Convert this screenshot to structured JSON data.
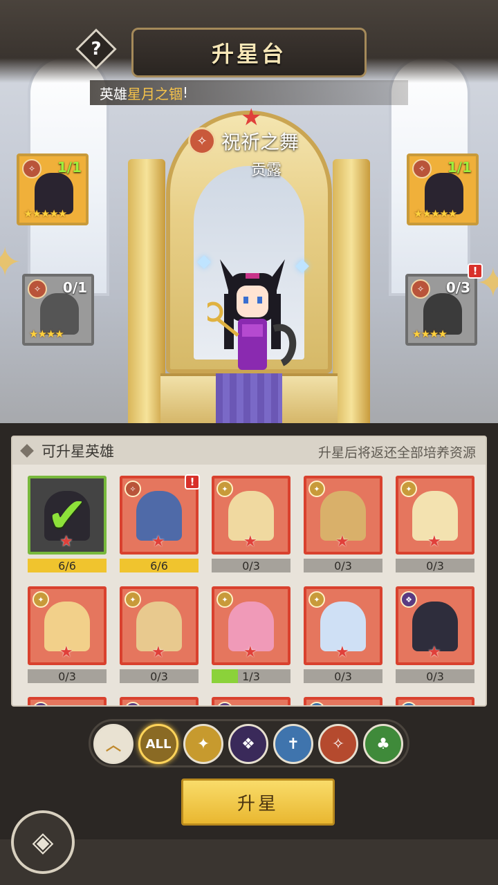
{
  "header": {
    "title": "升星台",
    "help": "?"
  },
  "banner": {
    "prefix": "英雄",
    "highlight": "星月之锢",
    "suffix": "!"
  },
  "featured": {
    "skill_name": "祝祈之舞",
    "hero_name": "贡露",
    "star": "★",
    "faction_icon": "fox-icon"
  },
  "side_cards": [
    {
      "id": "top-left",
      "count": "1/1",
      "stars": "★★★★★",
      "faction_icon": "fox-icon"
    },
    {
      "id": "top-right",
      "count": "1/1",
      "stars": "★★★★★",
      "faction_icon": "fox-icon"
    },
    {
      "id": "mid-left",
      "count": "0/1",
      "stars": "★★★★",
      "faction_icon": "fox-icon"
    },
    {
      "id": "mid-right",
      "count": "0/3",
      "stars": "★★★★",
      "faction_icon": "fox-icon",
      "alert": "!"
    }
  ],
  "panel": {
    "title": "可升星英雄",
    "note": "升星后将返还全部培养资源"
  },
  "heroes": [
    {
      "progress": "6/6",
      "fill_ratio": 1.0,
      "fill_color": "#f0c42e",
      "selected": true
    },
    {
      "progress": "6/6",
      "fill_ratio": 1.0,
      "fill_color": "#f0c42e",
      "alert": "!"
    },
    {
      "progress": "0/3",
      "fill_ratio": 0.0,
      "fill_color": "#8bd23a"
    },
    {
      "progress": "0/3",
      "fill_ratio": 0.0,
      "fill_color": "#8bd23a"
    },
    {
      "progress": "0/3",
      "fill_ratio": 0.0,
      "fill_color": "#8bd23a"
    },
    {
      "progress": "0/3",
      "fill_ratio": 0.0,
      "fill_color": "#8bd23a"
    },
    {
      "progress": "0/3",
      "fill_ratio": 0.0,
      "fill_color": "#8bd23a"
    },
    {
      "progress": "1/3",
      "fill_ratio": 0.333,
      "fill_color": "#8bd23a"
    },
    {
      "progress": "0/3",
      "fill_ratio": 0.0,
      "fill_color": "#8bd23a"
    },
    {
      "progress": "0/3",
      "fill_ratio": 0.0,
      "fill_color": "#8bd23a"
    }
  ],
  "filters": [
    {
      "label": "︿",
      "icon": "rank-chevron-icon",
      "color": "#e9e2d2"
    },
    {
      "label": "ALL",
      "icon": "all-icon",
      "color": "#8a6a24",
      "active": true
    },
    {
      "label": "✦",
      "icon": "light-faction-icon",
      "color": "#c79a2e"
    },
    {
      "label": "❖",
      "icon": "dark-faction-icon",
      "color": "#3a2a5a"
    },
    {
      "label": "✝",
      "icon": "holy-faction-icon",
      "color": "#3f74ad"
    },
    {
      "label": "✧",
      "icon": "fox-faction-icon",
      "color": "#b54a2e"
    },
    {
      "label": "♣",
      "icon": "nature-faction-icon",
      "color": "#3f8a3a"
    }
  ],
  "actions": {
    "star_up": "升星",
    "back": "◈"
  }
}
